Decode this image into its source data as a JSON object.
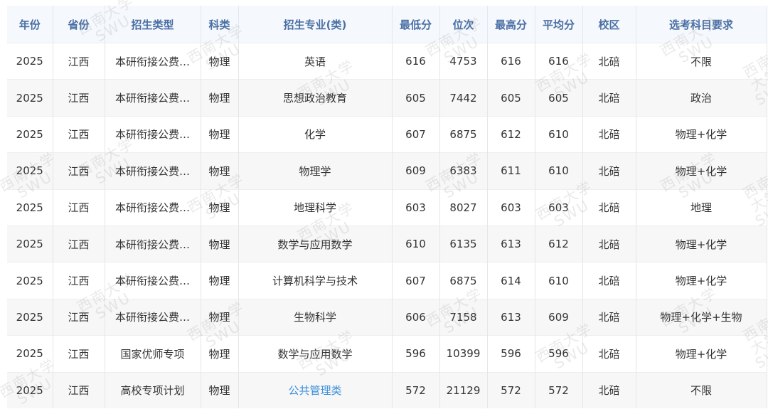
{
  "headers": [
    "年份",
    "省份",
    "招生类型",
    "科类",
    "招生专业(类)",
    "最低分",
    "位次",
    "最高分",
    "平均分",
    "校区",
    "选考科目要求"
  ],
  "rows": [
    [
      "2025",
      "江西",
      "本研衔接公费…",
      "物理",
      "英语",
      "616",
      "4753",
      "616",
      "616",
      "北碚",
      "不限"
    ],
    [
      "2025",
      "江西",
      "本研衔接公费…",
      "物理",
      "思想政治教育",
      "605",
      "7442",
      "605",
      "605",
      "北碚",
      "政治"
    ],
    [
      "2025",
      "江西",
      "本研衔接公费…",
      "物理",
      "化学",
      "607",
      "6875",
      "612",
      "610",
      "北碚",
      "物理+化学"
    ],
    [
      "2025",
      "江西",
      "本研衔接公费…",
      "物理",
      "物理学",
      "609",
      "6383",
      "611",
      "610",
      "北碚",
      "物理+化学"
    ],
    [
      "2025",
      "江西",
      "本研衔接公费…",
      "物理",
      "地理科学",
      "603",
      "8027",
      "603",
      "603",
      "北碚",
      "地理"
    ],
    [
      "2025",
      "江西",
      "本研衔接公费…",
      "物理",
      "数学与应用数学",
      "610",
      "6135",
      "613",
      "612",
      "北碚",
      "物理+化学"
    ],
    [
      "2025",
      "江西",
      "本研衔接公费…",
      "物理",
      "计算机科学与技术",
      "607",
      "6875",
      "614",
      "610",
      "北碚",
      "物理+化学"
    ],
    [
      "2025",
      "江西",
      "本研衔接公费…",
      "物理",
      "生物科学",
      "606",
      "7158",
      "613",
      "609",
      "北碚",
      "物理+化学+生物"
    ],
    [
      "2025",
      "江西",
      "国家优师专项",
      "物理",
      "数学与应用数学",
      "596",
      "10399",
      "596",
      "596",
      "北碚",
      "物理+化学"
    ],
    [
      "2025",
      "江西",
      "高校专项计划",
      "物理",
      "公共管理类",
      "572",
      "21129",
      "572",
      "572",
      "北碚",
      "不限"
    ]
  ],
  "watermark": {
    "cn": "西南大学",
    "en": "SWU"
  },
  "colors": {
    "header_text": "#4a6fa5",
    "link": "#3b8fd9"
  }
}
